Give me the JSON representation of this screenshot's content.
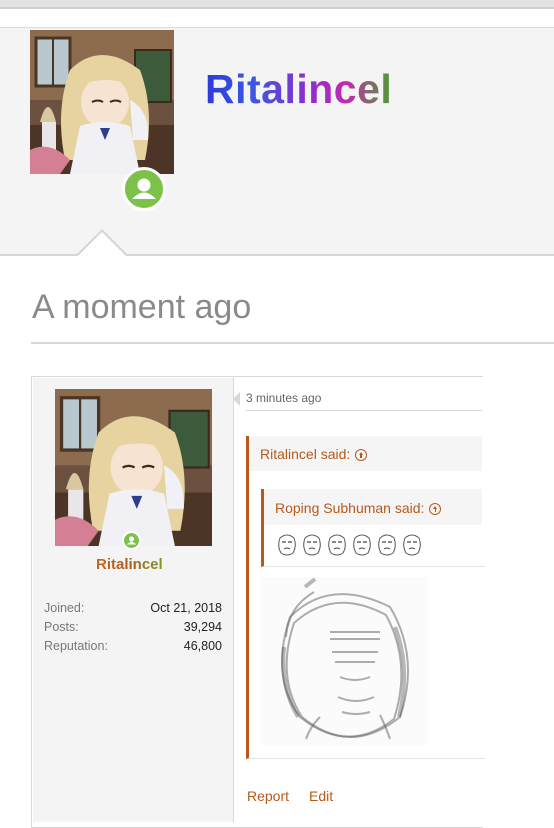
{
  "profile": {
    "username": "Ritalincel",
    "status": "online"
  },
  "activity": {
    "heading": "A moment ago"
  },
  "post": {
    "author": {
      "username": "Ritalincel",
      "stats": [
        {
          "label": "Joined:",
          "value": "Oct 21, 2018"
        },
        {
          "label": "Posts:",
          "value": "39,294"
        },
        {
          "label": "Reputation:",
          "value": "46,800"
        }
      ]
    },
    "timestamp": "3 minutes ago",
    "quote": {
      "author_said": "Ritalincel said:",
      "nested_quote": {
        "author_said": "Roping Subhuman said:",
        "emoji_count": 6
      }
    },
    "actions": {
      "report": "Report",
      "edit": "Edit"
    }
  },
  "colors": {
    "accent": "#b8591b",
    "online": "#7cc14a"
  }
}
